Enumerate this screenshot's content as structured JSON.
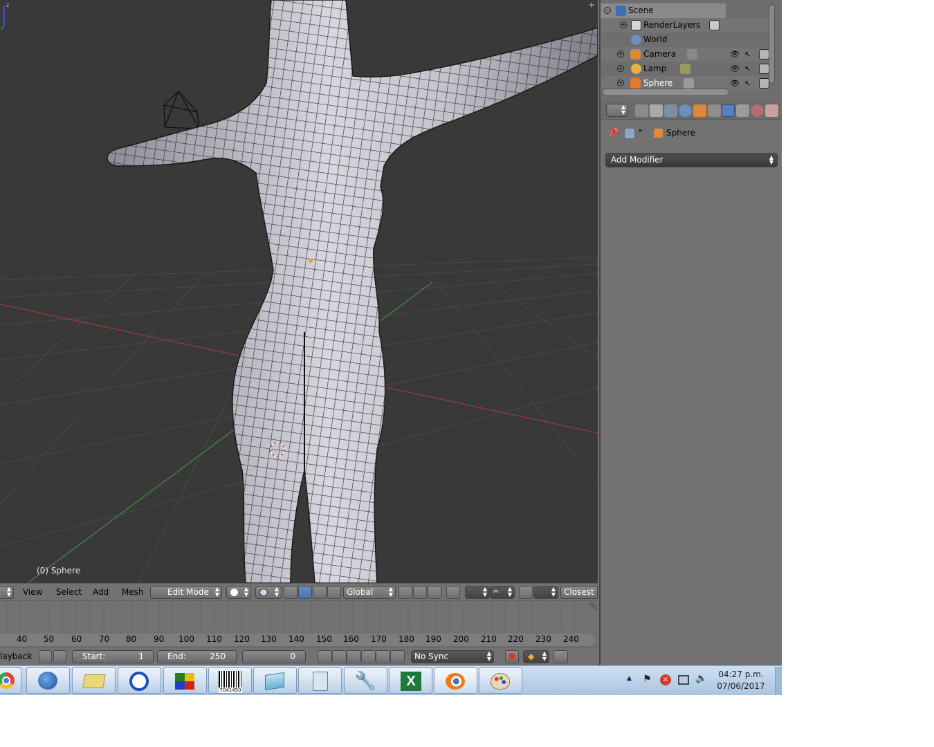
{
  "viewport": {
    "object_label": "(0) Sphere",
    "corner_symbol": "+"
  },
  "view_header": {
    "menus": [
      "View",
      "Select",
      "Add",
      "Mesh"
    ],
    "mode": "Edit Mode",
    "orientation": "Global",
    "snap_target": "Closest"
  },
  "timeline": {
    "ticks": [
      "40",
      "50",
      "60",
      "70",
      "80",
      "90",
      "100",
      "110",
      "120",
      "130",
      "140",
      "150",
      "160",
      "170",
      "180",
      "190",
      "200",
      "210",
      "220",
      "230",
      "240"
    ],
    "playback_label": "layback",
    "start_label": "Start:",
    "start_value": "1",
    "end_label": "End:",
    "end_value": "250",
    "current_frame": "0",
    "sync": "No Sync"
  },
  "outliner": {
    "rows": [
      {
        "label": "Scene",
        "icon": "scene-icon"
      },
      {
        "label": "RenderLayers",
        "icon": "render-layers-icon"
      },
      {
        "label": "World",
        "icon": "world-icon"
      },
      {
        "label": "Camera",
        "icon": "camera-icon"
      },
      {
        "label": "Lamp",
        "icon": "lamp-icon"
      },
      {
        "label": "Sphere",
        "icon": "mesh-icon"
      }
    ]
  },
  "properties": {
    "breadcrumb_object": "Sphere",
    "add_modifier": "Add Modifier"
  },
  "taskbar": {
    "apps": [
      "chrome-icon",
      "thunderbird-icon",
      "file-explorer-icon",
      "media-player-icon",
      "grid-app-icon",
      "barcode-app-icon",
      "notes-app-icon",
      "calculator-icon",
      "tools-icon",
      "excel-icon",
      "blender-icon",
      "paint-icon"
    ],
    "barcode_caption": "7041450",
    "time": "04:27 p.m.",
    "date": "07/06/2017"
  },
  "colors": {
    "viewport_bg": "#393939",
    "panel_bg": "#727272",
    "selection_blue": "#5680c2",
    "x_axis": "#9a3a3a",
    "y_axis": "#3f8a3f"
  }
}
